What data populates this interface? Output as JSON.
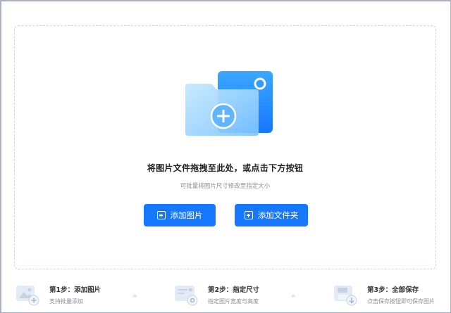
{
  "drop_zone": {
    "title": "将图片文件拖拽至此处，或点击下方按钮",
    "subtitle": "可批量将图片尺寸修改至指定大小",
    "add_image_label": "添加图片",
    "add_folder_label": "添加文件夹"
  },
  "steps": [
    {
      "title": "第1步：添加图片",
      "desc": "支持批量添加",
      "icon": "add-image-icon"
    },
    {
      "title": "第2步：指定尺寸",
      "desc": "指定图片宽度与高度",
      "icon": "set-size-icon"
    },
    {
      "title": "第3步：全部保存",
      "desc": "点击保存按钮即可保存图片",
      "icon": "save-icon"
    }
  ],
  "arrows": [
    "»",
    "»"
  ],
  "colors": {
    "accent": "#1677ff",
    "folder_back": "#1e90ff",
    "folder_front": "#8fd0ff",
    "dashed_border": "#cfd5de"
  }
}
